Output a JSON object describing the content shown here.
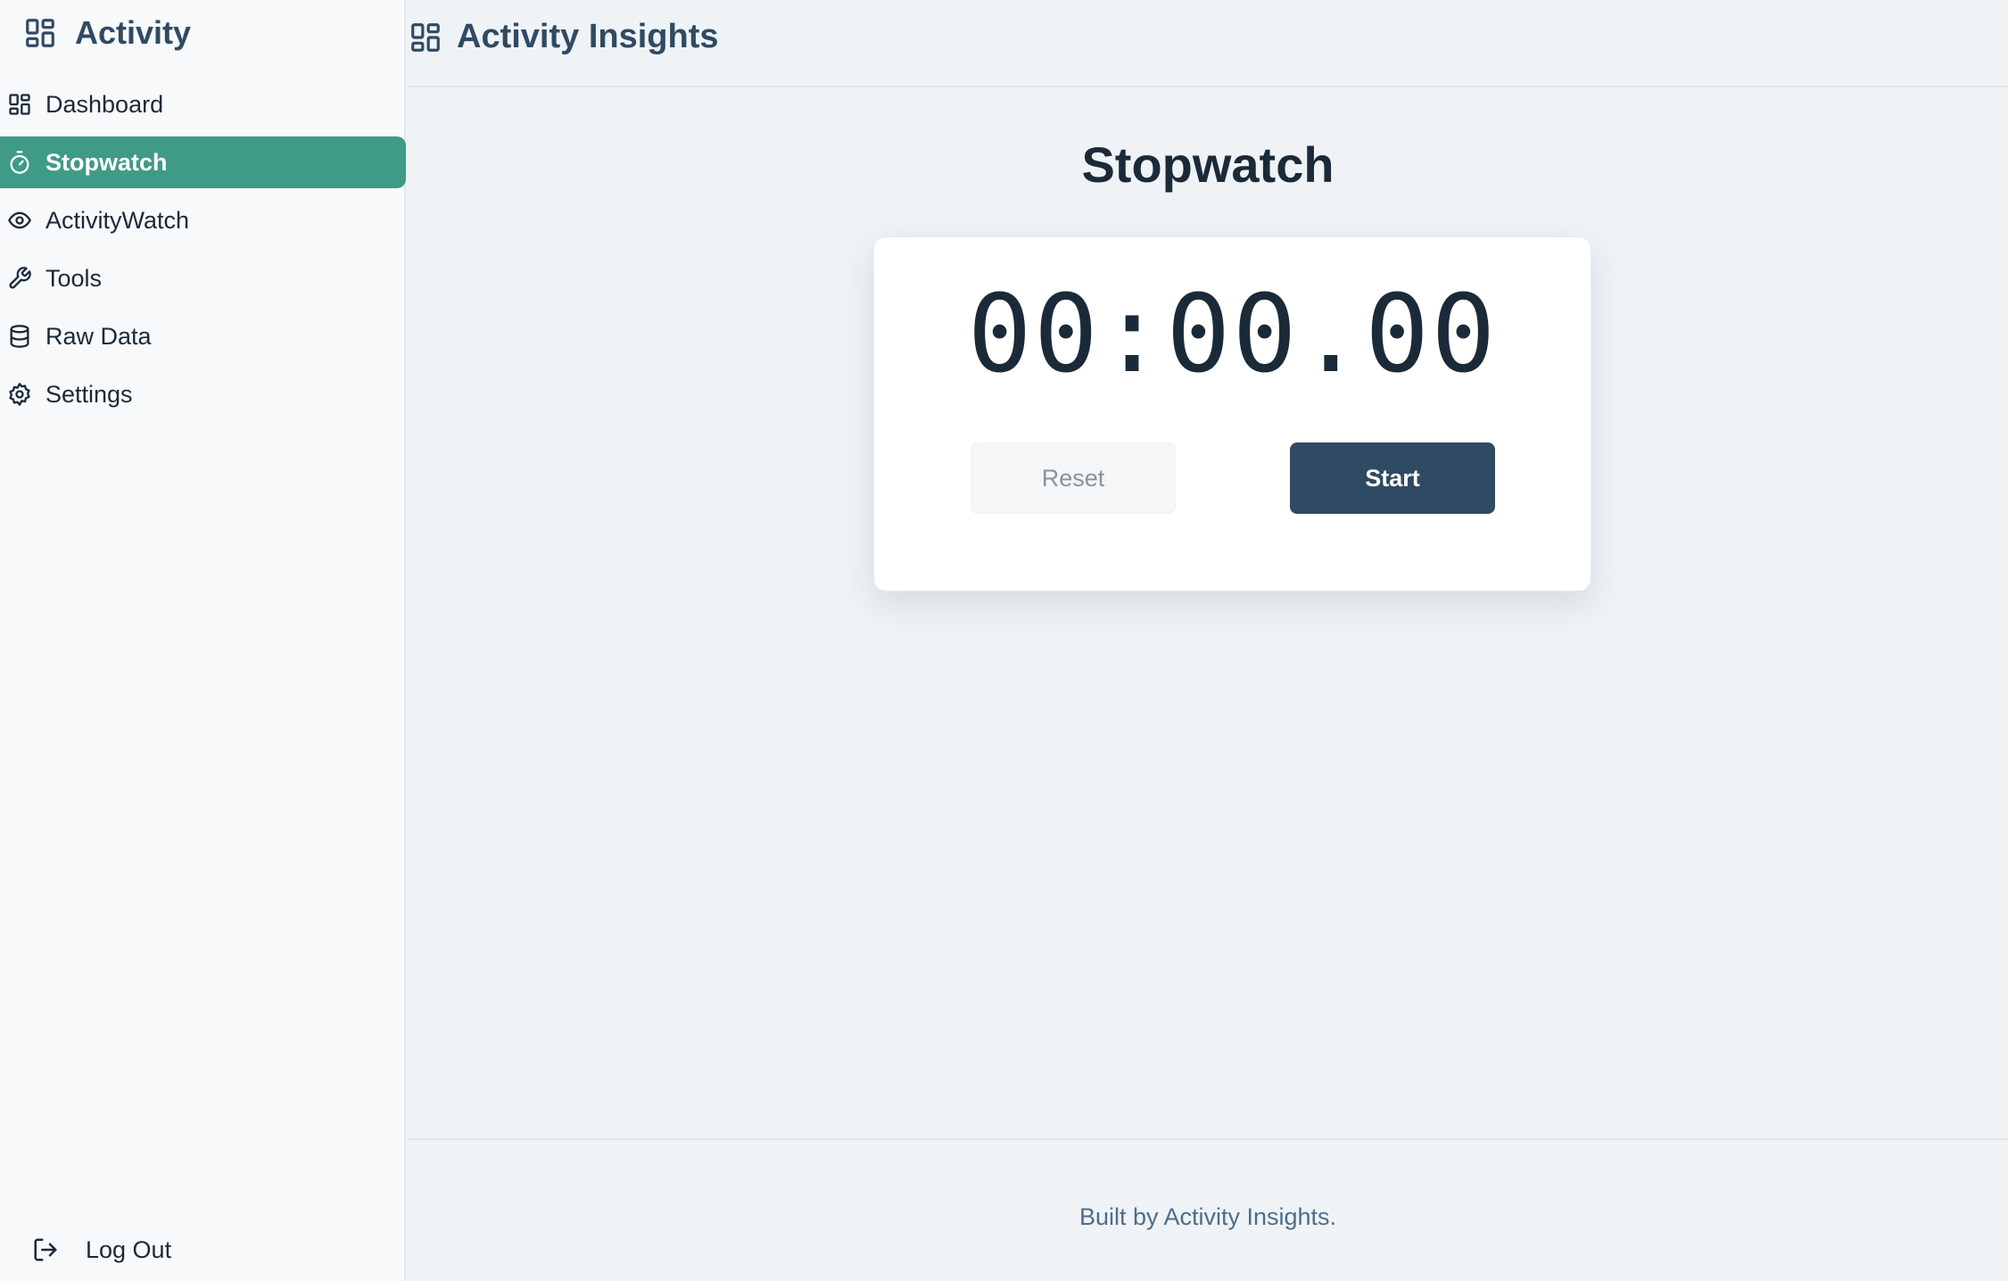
{
  "sidebar": {
    "brand": {
      "label": "Activity",
      "icon": "layout-grid-icon"
    },
    "items": [
      {
        "label": "Dashboard",
        "icon": "layout-grid-icon",
        "active": false
      },
      {
        "label": "Stopwatch",
        "icon": "timer-icon",
        "active": true
      },
      {
        "label": "ActivityWatch",
        "icon": "eye-icon",
        "active": false
      },
      {
        "label": "Tools",
        "icon": "wrench-icon",
        "active": false
      },
      {
        "label": "Raw Data",
        "icon": "database-icon",
        "active": false
      },
      {
        "label": "Settings",
        "icon": "gear-icon",
        "active": false
      }
    ],
    "logout": {
      "label": "Log Out",
      "icon": "log-out-icon"
    }
  },
  "header": {
    "title": "Activity Insights",
    "icon": "layout-grid-icon"
  },
  "main": {
    "title": "Stopwatch",
    "timer": "00:00.00",
    "reset_label": "Reset",
    "start_label": "Start"
  },
  "footer": {
    "text": "Built by Activity Insights."
  },
  "colors": {
    "accent": "#3f9b86",
    "primary": "#2f4a63",
    "background": "#eff3f6",
    "sidebar": "#f7f9fb"
  }
}
